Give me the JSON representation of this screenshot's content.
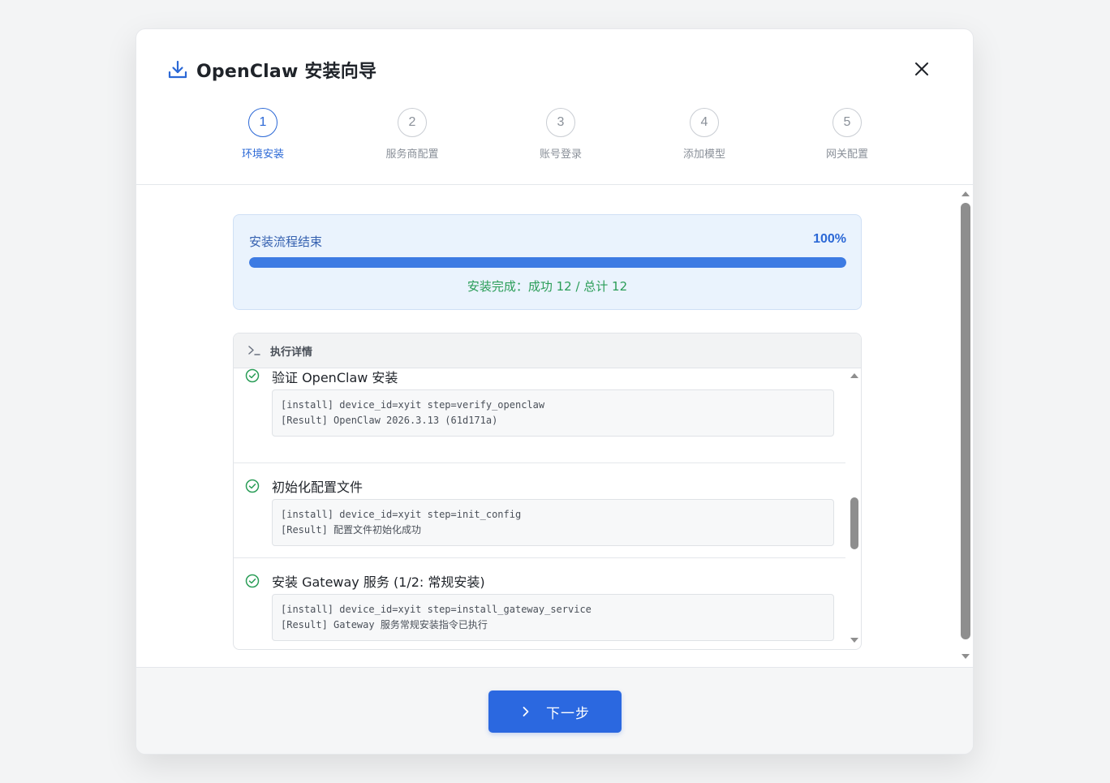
{
  "dialog": {
    "title": "OpenClaw 安装向导",
    "title_icon": "download-icon",
    "close_icon": "close-icon"
  },
  "steps": [
    {
      "number": "1",
      "label": "环境安装",
      "active": true
    },
    {
      "number": "2",
      "label": "服务商配置",
      "active": false
    },
    {
      "number": "3",
      "label": "账号登录",
      "active": false
    },
    {
      "number": "4",
      "label": "添加模型",
      "active": false
    },
    {
      "number": "5",
      "label": "网关配置",
      "active": false
    }
  ],
  "progress": {
    "title": "安装流程结束",
    "percent_label": "100%",
    "percent_value": 100,
    "result": "安装完成：成功 12 / 总计 12"
  },
  "details": {
    "header": "执行详情",
    "entries": [
      {
        "title": "验证 OpenClaw 安装",
        "status": "success",
        "log_lines": [
          "[install] device_id=xyit step=verify_openclaw",
          "[Result] OpenClaw 2026.3.13 (61d171a)"
        ]
      },
      {
        "title": "初始化配置文件",
        "status": "success",
        "log_lines": [
          "[install] device_id=xyit step=init_config",
          "[Result] 配置文件初始化成功"
        ]
      },
      {
        "title": "安装 Gateway 服务 (1/2: 常规安装)",
        "status": "success",
        "log_lines": [
          "[install] device_id=xyit step=install_gateway_service",
          "[Result] Gateway 服务常规安装指令已执行"
        ]
      }
    ]
  },
  "footer": {
    "next_label": "下一步"
  },
  "colors": {
    "accent": "#2b68e0",
    "success": "#2a9d57",
    "progress_bg": "#eaf3fd"
  }
}
